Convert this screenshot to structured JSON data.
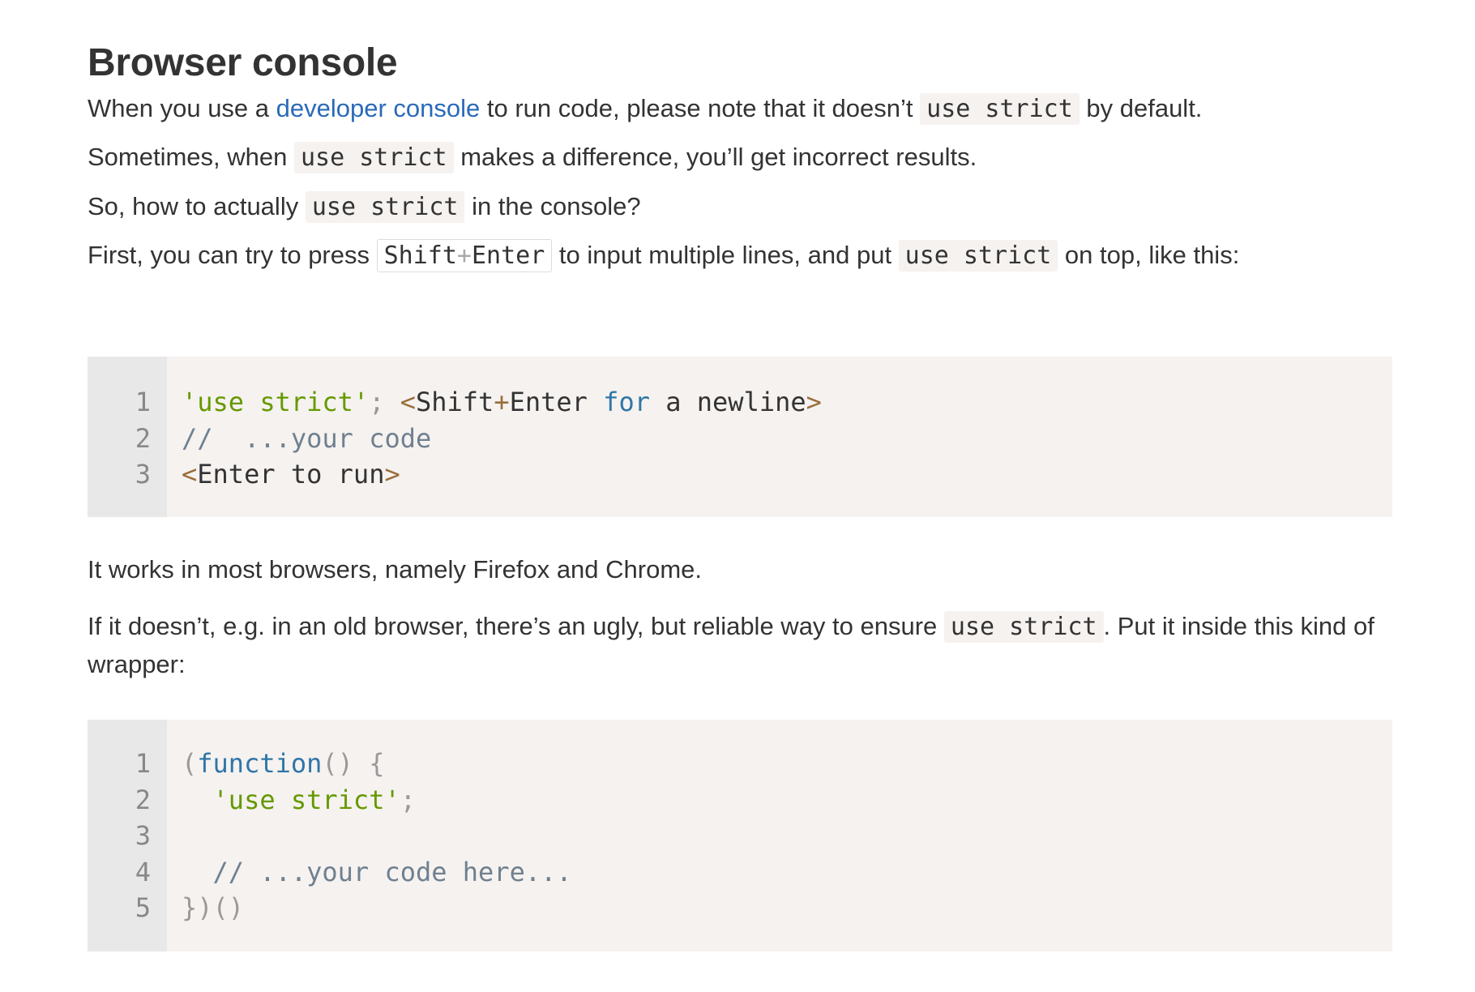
{
  "section": {
    "title": "Browser console"
  },
  "p1": {
    "before": "When you use a ",
    "link": "developer console",
    "middle": " to run code, please note that it doesn’t ",
    "code": "use strict",
    "after": " by default."
  },
  "p2": {
    "before": "Sometimes, when ",
    "code": "use strict",
    "after": " makes a difference, you’ll get incorrect results."
  },
  "p3": {
    "before": "So, how to actually ",
    "code": "use strict",
    "after": " in the console?"
  },
  "p4": {
    "before": "First, you can try to press ",
    "kbd_key1": "Shift",
    "kbd_plus": "+",
    "kbd_key2": "Enter",
    "middle": " to input multiple lines, and put ",
    "code": "use strict",
    "after": " on top, like this:"
  },
  "code1": {
    "line_numbers": [
      "1",
      "2",
      "3"
    ],
    "lines": [
      {
        "str": "'use strict'",
        "semi": ";",
        "sp": " ",
        "lt": "<",
        "w1": "Shift",
        "plus": "+",
        "w2": "Enter ",
        "kw": "for",
        "rest": " a newline",
        "gt": ">"
      },
      {
        "comment": "//  ...your code"
      },
      {
        "lt": "<",
        "text": "Enter to run",
        "gt": ">"
      }
    ]
  },
  "p5": {
    "text": "It works in most browsers, namely Firefox and Chrome."
  },
  "p6": {
    "before": "If it doesn’t, e.g. in an old browser, there’s an ugly, but reliable way to ensure ",
    "code": "use strict",
    "after": ". Put it inside this kind of wrapper:"
  },
  "code2": {
    "line_numbers": [
      "1",
      "2",
      "3",
      "4",
      "5"
    ],
    "lines": [
      {
        "p1": "(",
        "kw": "function",
        "p2": "() {"
      },
      {
        "indent": "  ",
        "str": "'use strict'",
        "semi": ";"
      },
      {},
      {
        "indent": "  ",
        "comment": "// ...your code here..."
      },
      {
        "p": "})()"
      }
    ]
  }
}
